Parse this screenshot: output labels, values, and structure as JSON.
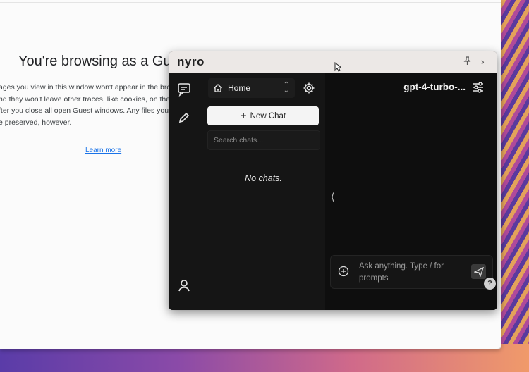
{
  "browser": {
    "title": "You're browsing as a Gue",
    "body_lines": [
      "ages you view in this window won't appear in the brow",
      "nd they won't leave other traces, like cookies, on the co",
      "fter you close all open Guest windows. Any files you do",
      "e preserved, however."
    ],
    "learn_more": "Learn more"
  },
  "nyro": {
    "logo": "nyro",
    "titlebar": {
      "pin_icon": "pin-icon",
      "expand_icon": "chevron-right-icon"
    },
    "rail": {
      "top_icons": [
        "chat-icon",
        "pencil-icon"
      ],
      "bottom_icon": "user-icon"
    },
    "panel": {
      "workspace": "Home",
      "new_chat": "New Chat",
      "search_placeholder": "Search chats...",
      "empty": "No chats."
    },
    "main": {
      "model": "gpt-4-turbo-...",
      "collapse_glyph": "⟨",
      "prompt_placeholder": "Ask anything. Type / for prompts",
      "help": "?"
    }
  },
  "colors": {
    "window_bg": "#0f0f0f",
    "titlebar_bg": "#ece8e6",
    "new_chat_bg": "#f4f4f4",
    "link": "#1a73e8"
  }
}
